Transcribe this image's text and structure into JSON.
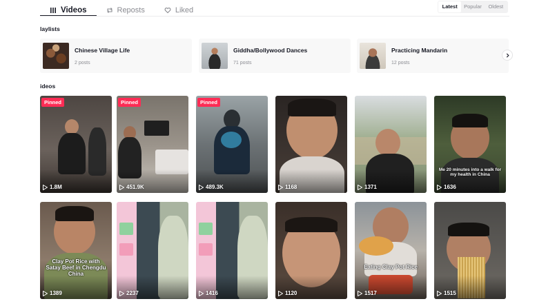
{
  "tabs": [
    {
      "label": "Videos",
      "icon": "grid-icon",
      "active": true
    },
    {
      "label": "Reposts",
      "icon": "repost-icon",
      "active": false
    },
    {
      "label": "Liked",
      "icon": "heart-icon",
      "active": false
    }
  ],
  "sort": {
    "options": [
      "Latest",
      "Popular",
      "Oldest"
    ],
    "selected": "Latest"
  },
  "playlists_section": {
    "title": "laylists"
  },
  "playlists": [
    {
      "name": "Chinese Village Life",
      "count": "2 posts"
    },
    {
      "name": "Giddha/Bollywood Dances",
      "count": "71 posts"
    },
    {
      "name": "Practicing Mandarin",
      "count": "12 posts"
    }
  ],
  "videos_section": {
    "title": "ideos"
  },
  "videos": [
    {
      "pinned": "Pinned",
      "views": "1.8M",
      "caption": ""
    },
    {
      "pinned": "Pinned",
      "views": "451.9K",
      "caption": ""
    },
    {
      "pinned": "Pinned",
      "views": "489.3K",
      "caption": ""
    },
    {
      "pinned": "",
      "views": "1168",
      "caption": ""
    },
    {
      "pinned": "",
      "views": "1371",
      "caption": ""
    },
    {
      "pinned": "",
      "views": "1636",
      "caption": "Me 20 minutes into a walk for my health in China"
    },
    {
      "pinned": "",
      "views": "1389",
      "caption": "Clay Pot Rice with Satay Beef in Chengdu China"
    },
    {
      "pinned": "",
      "views": "2237",
      "caption": ""
    },
    {
      "pinned": "",
      "views": "1416",
      "caption": ""
    },
    {
      "pinned": "",
      "views": "1120",
      "caption": ""
    },
    {
      "pinned": "",
      "views": "1517",
      "caption": "Eating Clay Pot Rice"
    },
    {
      "pinned": "",
      "views": "1515",
      "caption": ""
    }
  ],
  "colors": {
    "pinned_badge": "#fe2c55",
    "text_primary": "#161823",
    "text_secondary": "#8a8b91"
  }
}
